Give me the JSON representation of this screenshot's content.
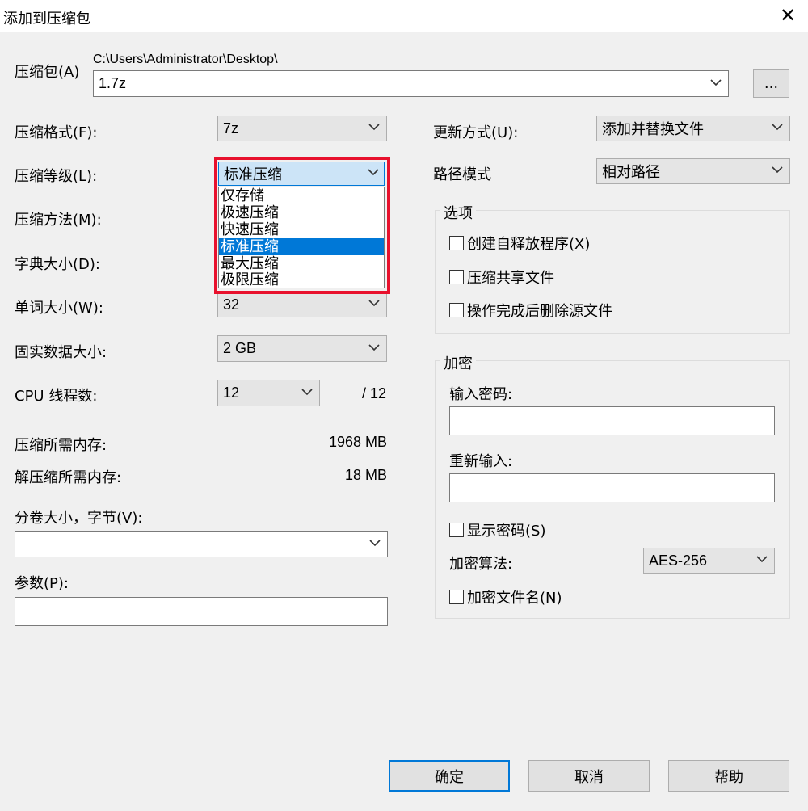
{
  "window": {
    "title": "添加到压缩包"
  },
  "archive": {
    "label": "压缩包(A)",
    "path": "C:\\Users\\Administrator\\Desktop\\",
    "filename": "1.7z",
    "browse_label": "..."
  },
  "left": {
    "format_label": "压缩格式(F):",
    "format_value": "7z",
    "level_label": "压缩等级(L):",
    "level_value": "标准压缩",
    "method_label": "压缩方法(M):",
    "dict_label": "字典大小(D):",
    "word_label": "单词大小(W):",
    "word_value": "32",
    "solid_label": "固实数据大小:",
    "solid_value": "2 GB",
    "threads_label": "CPU 线程数:",
    "threads_value": "12",
    "threads_max": "/ 12",
    "mem_comp_label": "压缩所需内存:",
    "mem_comp_value": "1968 MB",
    "mem_decomp_label": "解压缩所需内存:",
    "mem_decomp_value": "18 MB",
    "split_label": "分卷大小，字节(V):",
    "split_value": "",
    "params_label": "参数(P):",
    "params_value": ""
  },
  "level_dropdown": {
    "options": [
      "仅存储",
      "极速压缩",
      "快速压缩",
      "标准压缩",
      "最大压缩",
      "极限压缩"
    ],
    "selected_index": 3
  },
  "right": {
    "update_label": "更新方式(U):",
    "update_value": "添加并替换文件",
    "path_mode_label": "路径模式",
    "path_mode_value": "相对路径",
    "options_group": {
      "title": "选项",
      "sfx": "创建自释放程序(X)",
      "shared": "压缩共享文件",
      "delete_after": "操作完成后删除源文件"
    },
    "encryption_group": {
      "title": "加密",
      "password_label": "输入密码:",
      "password_value": "",
      "reenter_label": "重新输入:",
      "reenter_value": "",
      "show_password": "显示密码(S)",
      "method_label": "加密算法:",
      "method_value": "AES-256",
      "encrypt_names": "加密文件名(N)"
    }
  },
  "buttons": {
    "ok": "确定",
    "cancel": "取消",
    "help": "帮助"
  },
  "colors": {
    "highlight": "#e8112d",
    "selection": "#0078d7",
    "window_bg": "#f0f0f0"
  }
}
